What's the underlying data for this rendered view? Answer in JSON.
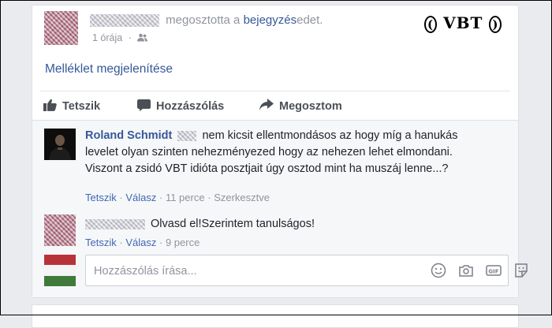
{
  "post": {
    "shared_text": "megosztotta a",
    "shared_link": "bejegyzés",
    "shared_suffix": "edet.",
    "time": "1 órája",
    "audience_icon": "friends-icon",
    "watermark": {
      "text": "VBT",
      "left_paren": "(",
      "right_paren": ")"
    },
    "attachment_link": "Melléklet megjelenítése"
  },
  "actions": [
    {
      "label": "Tetszik",
      "icon": "thumbs-up-icon"
    },
    {
      "label": "Hozzászólás",
      "icon": "comment-icon"
    },
    {
      "label": "Megosztom",
      "icon": "share-icon"
    }
  ],
  "comments": [
    {
      "author": "Roland Schmidt",
      "line1": "nem kicsit ellentmondásos az hogy míg a hanukás",
      "line2": "levelet olyan szinten nehezményezed hogy az nehezen lehet elmondani.",
      "line3": "Viszont a zsidó VBT idióta posztjait úgy osztod mint ha muszáj lenne...?",
      "like": "Tetszik",
      "reply": "Válasz",
      "time": "11 perce",
      "edited": "Szerkesztve",
      "separator": "·"
    },
    {
      "author": "",
      "text": "Olvasd el!Szerintem tanulságos!",
      "like": "Tetszik",
      "reply": "Válasz",
      "time": "9 perce",
      "separator": "·"
    }
  ],
  "composer": {
    "placeholder": "Hozzászólás írása...",
    "icons": [
      "emoji-icon",
      "camera-icon",
      "gif-icon",
      "sticker-icon"
    ]
  },
  "colors": {
    "link": "#365899",
    "meta": "#90949c",
    "background": "#e9ebee",
    "comments_bg": "#f6f7f9"
  }
}
